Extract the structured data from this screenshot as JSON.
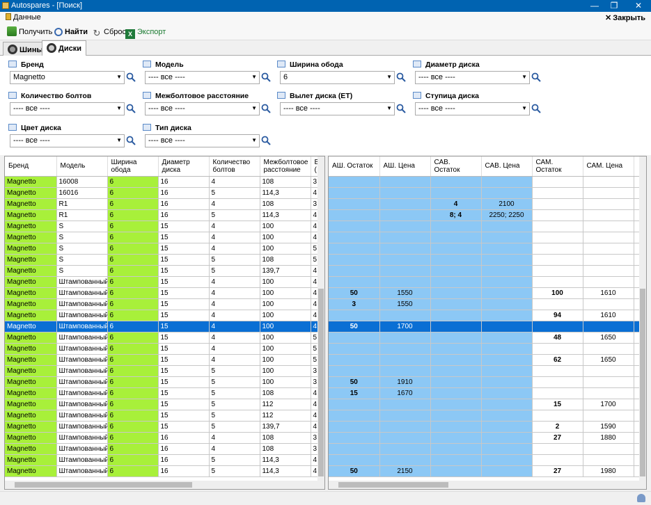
{
  "window": {
    "title": "Autospares - [Поиск]"
  },
  "menu": {
    "data_label": "Данные",
    "close_label": "Закрыть"
  },
  "toolbar": {
    "get": "Получить",
    "find": "Найти",
    "reset": "Сброс",
    "export": "Экспорт"
  },
  "tabs": [
    {
      "label": "Шины"
    },
    {
      "label": "Диски"
    }
  ],
  "filters": {
    "brand": {
      "label": "Бренд",
      "value": "Magnetto"
    },
    "model": {
      "label": "Модель",
      "value": "---- все ----"
    },
    "rim_width": {
      "label": "Ширина обода",
      "value": "6"
    },
    "diameter": {
      "label": "Диаметр диска",
      "value": "---- все ----"
    },
    "bolts": {
      "label": "Количество болтов",
      "value": "---- все ----"
    },
    "pcd": {
      "label": "Межболтовое расстояние",
      "value": "---- все ----"
    },
    "et": {
      "label": "Вылет диска (ET)",
      "value": "---- все ----"
    },
    "hub": {
      "label": "Ступица диска",
      "value": "---- все ----"
    },
    "color": {
      "label": "Цвет диска",
      "value": "---- все ----"
    },
    "type": {
      "label": "Тип диска",
      "value": "---- все ----"
    }
  },
  "left_table": {
    "headers": [
      "Бренд",
      "Модель",
      "Ширина обода",
      "Диаметр диска",
      "Количество болтов",
      "Межболтовое расстояние",
      "В ("
    ],
    "rows": [
      [
        "Magnetto",
        "16008",
        "6",
        "16",
        "4",
        "108",
        "3"
      ],
      [
        "Magnetto",
        "16016",
        "6",
        "16",
        "5",
        "114,3",
        "4"
      ],
      [
        "Magnetto",
        "R1",
        "6",
        "16",
        "4",
        "108",
        "3"
      ],
      [
        "Magnetto",
        "R1",
        "6",
        "16",
        "5",
        "114,3",
        "4"
      ],
      [
        "Magnetto",
        "S",
        "6",
        "15",
        "4",
        "100",
        "4"
      ],
      [
        "Magnetto",
        "S",
        "6",
        "15",
        "4",
        "100",
        "4"
      ],
      [
        "Magnetto",
        "S",
        "6",
        "15",
        "4",
        "100",
        "5"
      ],
      [
        "Magnetto",
        "S",
        "6",
        "15",
        "5",
        "108",
        "5"
      ],
      [
        "Magnetto",
        "S",
        "6",
        "15",
        "5",
        "139,7",
        "4"
      ],
      [
        "Magnetto",
        "Штампованный",
        "6",
        "15",
        "4",
        "100",
        "4"
      ],
      [
        "Magnetto",
        "Штампованный",
        "6",
        "15",
        "4",
        "100",
        "4"
      ],
      [
        "Magnetto",
        "Штампованный",
        "6",
        "15",
        "4",
        "100",
        "4"
      ],
      [
        "Magnetto",
        "Штампованный",
        "6",
        "15",
        "4",
        "100",
        "4"
      ],
      [
        "Magnetto",
        "Штампованный",
        "6",
        "15",
        "4",
        "100",
        "4"
      ],
      [
        "Magnetto",
        "Штампованный",
        "6",
        "15",
        "4",
        "100",
        "5"
      ],
      [
        "Magnetto",
        "Штампованный",
        "6",
        "15",
        "4",
        "100",
        "5"
      ],
      [
        "Magnetto",
        "Штампованный",
        "6",
        "15",
        "4",
        "100",
        "5"
      ],
      [
        "Magnetto",
        "Штампованный",
        "6",
        "15",
        "5",
        "100",
        "3"
      ],
      [
        "Magnetto",
        "Штампованный",
        "6",
        "15",
        "5",
        "100",
        "3"
      ],
      [
        "Magnetto",
        "Штампованный",
        "6",
        "15",
        "5",
        "108",
        "4"
      ],
      [
        "Magnetto",
        "Штампованный",
        "6",
        "15",
        "5",
        "112",
        "4"
      ],
      [
        "Magnetto",
        "Штампованный",
        "6",
        "15",
        "5",
        "112",
        "4"
      ],
      [
        "Magnetto",
        "Штампованный",
        "6",
        "15",
        "5",
        "139,7",
        "4"
      ],
      [
        "Magnetto",
        "Штампованный",
        "6",
        "16",
        "4",
        "108",
        "3"
      ],
      [
        "Magnetto",
        "Штампованный",
        "6",
        "16",
        "4",
        "108",
        "3"
      ],
      [
        "Magnetto",
        "Штампованный",
        "6",
        "16",
        "5",
        "114,3",
        "4"
      ],
      [
        "Magnetto",
        "Штампованный",
        "6",
        "16",
        "5",
        "114,3",
        "4"
      ]
    ],
    "selected_row": 13
  },
  "right_table": {
    "headers": [
      "АШ. Остаток",
      "АШ. Цена",
      "САВ. Остаток",
      "САВ. Цена",
      "САМ. Остаток",
      "САМ. Цена",
      ""
    ],
    "rows": [
      [
        "",
        "",
        "",
        "",
        "",
        "",
        ""
      ],
      [
        "",
        "",
        "",
        "",
        "",
        "",
        ""
      ],
      [
        "",
        "",
        "4",
        "2100",
        "",
        "",
        ""
      ],
      [
        "",
        "",
        "8; 4",
        "2250; 2250",
        "",
        "",
        ""
      ],
      [
        "",
        "",
        "",
        "",
        "",
        "",
        ""
      ],
      [
        "",
        "",
        "",
        "",
        "",
        "",
        ""
      ],
      [
        "",
        "",
        "",
        "",
        "",
        "",
        ""
      ],
      [
        "",
        "",
        "",
        "",
        "",
        "",
        ""
      ],
      [
        "",
        "",
        "",
        "",
        "",
        "",
        ""
      ],
      [
        "",
        "",
        "",
        "",
        "",
        "",
        ""
      ],
      [
        "50",
        "1550",
        "",
        "",
        "100",
        "1610",
        ""
      ],
      [
        "3",
        "1550",
        "",
        "",
        "",
        "",
        ""
      ],
      [
        "",
        "",
        "",
        "",
        "94",
        "1610",
        ""
      ],
      [
        "50",
        "1700",
        "",
        "",
        "",
        "",
        ""
      ],
      [
        "",
        "",
        "",
        "",
        "48",
        "1650",
        ""
      ],
      [
        "",
        "",
        "",
        "",
        "",
        "",
        ""
      ],
      [
        "",
        "",
        "",
        "",
        "62",
        "1650",
        ""
      ],
      [
        "",
        "",
        "",
        "",
        "",
        "",
        ""
      ],
      [
        "50",
        "1910",
        "",
        "",
        "",
        "",
        ""
      ],
      [
        "15",
        "1670",
        "",
        "",
        "",
        "",
        ""
      ],
      [
        "",
        "",
        "",
        "",
        "15",
        "1700",
        ""
      ],
      [
        "",
        "",
        "",
        "",
        "",
        "",
        ""
      ],
      [
        "",
        "",
        "",
        "",
        "2",
        "1590",
        ""
      ],
      [
        "",
        "",
        "",
        "",
        "27",
        "1880",
        ""
      ],
      [
        "",
        "",
        "",
        "",
        "",
        "",
        ""
      ],
      [
        "",
        "",
        "",
        "",
        "",
        "",
        ""
      ],
      [
        "50",
        "2150",
        "",
        "",
        "27",
        "1980",
        ""
      ]
    ]
  },
  "colors": {
    "brand_green": "#a8f03a",
    "stock_blue": "#8cc8f5",
    "selection": "#0a6fd4",
    "titlebar": "#0063b1"
  }
}
